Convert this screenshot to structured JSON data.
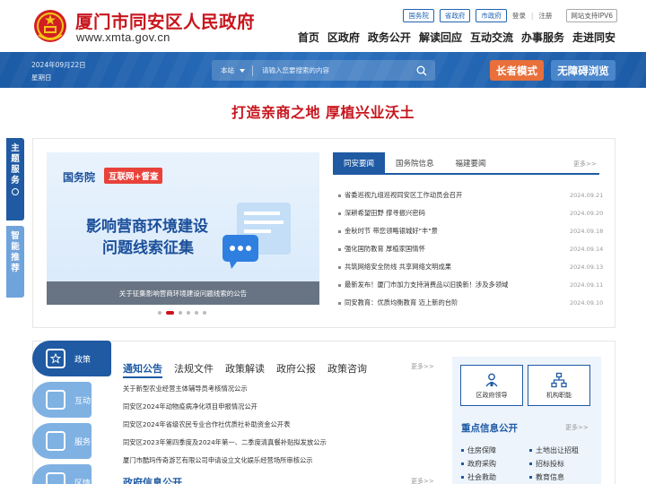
{
  "header": {
    "title": "厦门市同安区人民政府",
    "url": "www.xmta.gov.cn",
    "top_links": [
      "国务院",
      "省政府",
      "市政府"
    ],
    "login": "登录",
    "sep": "|",
    "register": "注册",
    "ipv6": "网站支持IPV6",
    "nav": [
      "首页",
      "区政府",
      "政务公开",
      "解读回应",
      "互动交流",
      "办事服务",
      "走进同安"
    ]
  },
  "banner": {
    "date": "2024年09月22日",
    "weekday": "星期日",
    "search_scope": "本站",
    "search_placeholder": "请输入您要搜索的内容",
    "elder_mode": "长者模式",
    "accessible": "无障碍浏览"
  },
  "slogan": "打造亲商之地  厚植兴业沃土",
  "side_tabs": {
    "topic": "主题服务",
    "smart": "智能推荐"
  },
  "carousel": {
    "tag_a": "国务院",
    "tag_b": "互联网+督查",
    "headline_1": "影响营商环境建设",
    "headline_2": "问题线索征集",
    "caption": "关于征集影响营商环境建设问题线索的公告",
    "slide_count": 6,
    "active_slide": 1
  },
  "news": {
    "tabs": [
      "同安要闻",
      "国务院信息",
      "福建要闻"
    ],
    "active_tab": 0,
    "more": "更多>>",
    "items": [
      {
        "title": "省委巡视九组巡视同安区工作动员会召开",
        "date": "2024.09.21"
      },
      {
        "title": "深耕希望田野 撑寻振兴密码",
        "date": "2024.09.20"
      },
      {
        "title": "金秋时节 带您领略银城好\"丰\"景",
        "date": "2024.09.18"
      },
      {
        "title": "强化国防教育 厚植家国情怀",
        "date": "2024.09.14"
      },
      {
        "title": "共筑网络安全防线 共享网络文明成果",
        "date": "2024.09.13"
      },
      {
        "title": "最新发布！厦门市加力支持消费品以旧换新！涉及多领域",
        "date": "2024.09.11"
      },
      {
        "title": "同安教育：优质均衡教育 迈上新的台阶",
        "date": "2024.09.10"
      }
    ]
  },
  "categories": [
    "政策",
    "互动",
    "服务",
    "区情"
  ],
  "policy": {
    "tabs": [
      "通知公告",
      "法规文件",
      "政策解读",
      "政府公报",
      "政策咨询"
    ],
    "active_tab": 0,
    "more": "更多>>",
    "items": [
      "关于新型农业经营主体辅导员考核情况公示",
      "同安区2024年动物疫病净化项目申报情况公开",
      "同安区2024年省级农民专业合作社优质社补助资金公开表",
      "同安区2023年第四季度及2024年第一、二季度清真餐补贴拟发放公示",
      "厦门市酷玛传奇游艺有限公司申请设立文化娱乐经营场所审核公示"
    ],
    "gov_info_title": "政府信息公开",
    "gov_info_more": "更多>>"
  },
  "quick_links": [
    "区政府领导",
    "机构职能"
  ],
  "key_info": {
    "title": "重点信息公开",
    "more": "更多>>",
    "items": [
      "住房保障",
      "土地出让招租",
      "政府采购",
      "招标投标",
      "社会救助",
      "教育信息"
    ]
  },
  "colors": {
    "brand_red": "#c8151d",
    "brand_blue": "#1f5aa3",
    "elder_orange": "#e9703b",
    "access_blue": "#4a86cc"
  }
}
